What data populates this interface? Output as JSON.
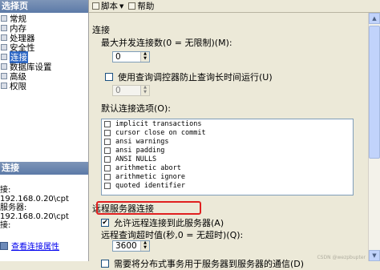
{
  "left": {
    "pages_header": "选择页",
    "pages": [
      {
        "label": "常规",
        "selected": false
      },
      {
        "label": "内存",
        "selected": false
      },
      {
        "label": "处理器",
        "selected": false
      },
      {
        "label": "安全性",
        "selected": false
      },
      {
        "label": "连接",
        "selected": true
      },
      {
        "label": "数据库设置",
        "selected": false
      },
      {
        "label": "高级",
        "selected": false
      },
      {
        "label": "权限",
        "selected": false
      }
    ],
    "connection_header": "连接",
    "connection_lines": [
      "接:",
      "192.168.0.20\\cpt",
      "服务器:",
      "192.168.0.20\\cpt",
      "接:"
    ],
    "view_properties_link": "查看连接属性"
  },
  "toolbar": {
    "script_label": "脚本",
    "help_label": "帮助"
  },
  "main": {
    "connections_section": "连接",
    "max_connections_label": "最大并发连接数(0 = 无限制)(M):",
    "max_connections_value": "0",
    "query_governor_label": "使用查询调控器防止查询长时间运行(U)",
    "query_governor_checked": false,
    "query_governor_value": "0",
    "default_options_label": "默认连接选项(O):",
    "default_options": [
      {
        "label": "implicit transactions",
        "checked": false
      },
      {
        "label": "cursor close on commit",
        "checked": false
      },
      {
        "label": "ansi warnings",
        "checked": false
      },
      {
        "label": "ansi padding",
        "checked": false
      },
      {
        "label": "ANSI NULLS",
        "checked": false
      },
      {
        "label": "arithmetic abort",
        "checked": false
      },
      {
        "label": "arithmetic ignore",
        "checked": false
      },
      {
        "label": "quoted identifier",
        "checked": false
      }
    ],
    "remote_section": "远程服务器连接",
    "allow_remote_label": "允许远程连接到此服务器(A)",
    "allow_remote_checked": true,
    "remote_timeout_label": "远程查询超时值(秒,0 = 无超时)(Q):",
    "remote_timeout_value": "3600",
    "distributed_tx_label": "需要将分布式事务用于服务器到服务器的通信(D)",
    "distributed_tx_checked": false
  },
  "watermark": "CSDN @wezpbupter",
  "colors": {
    "highlight_border": "#e02020",
    "selection": "#316ac5"
  }
}
